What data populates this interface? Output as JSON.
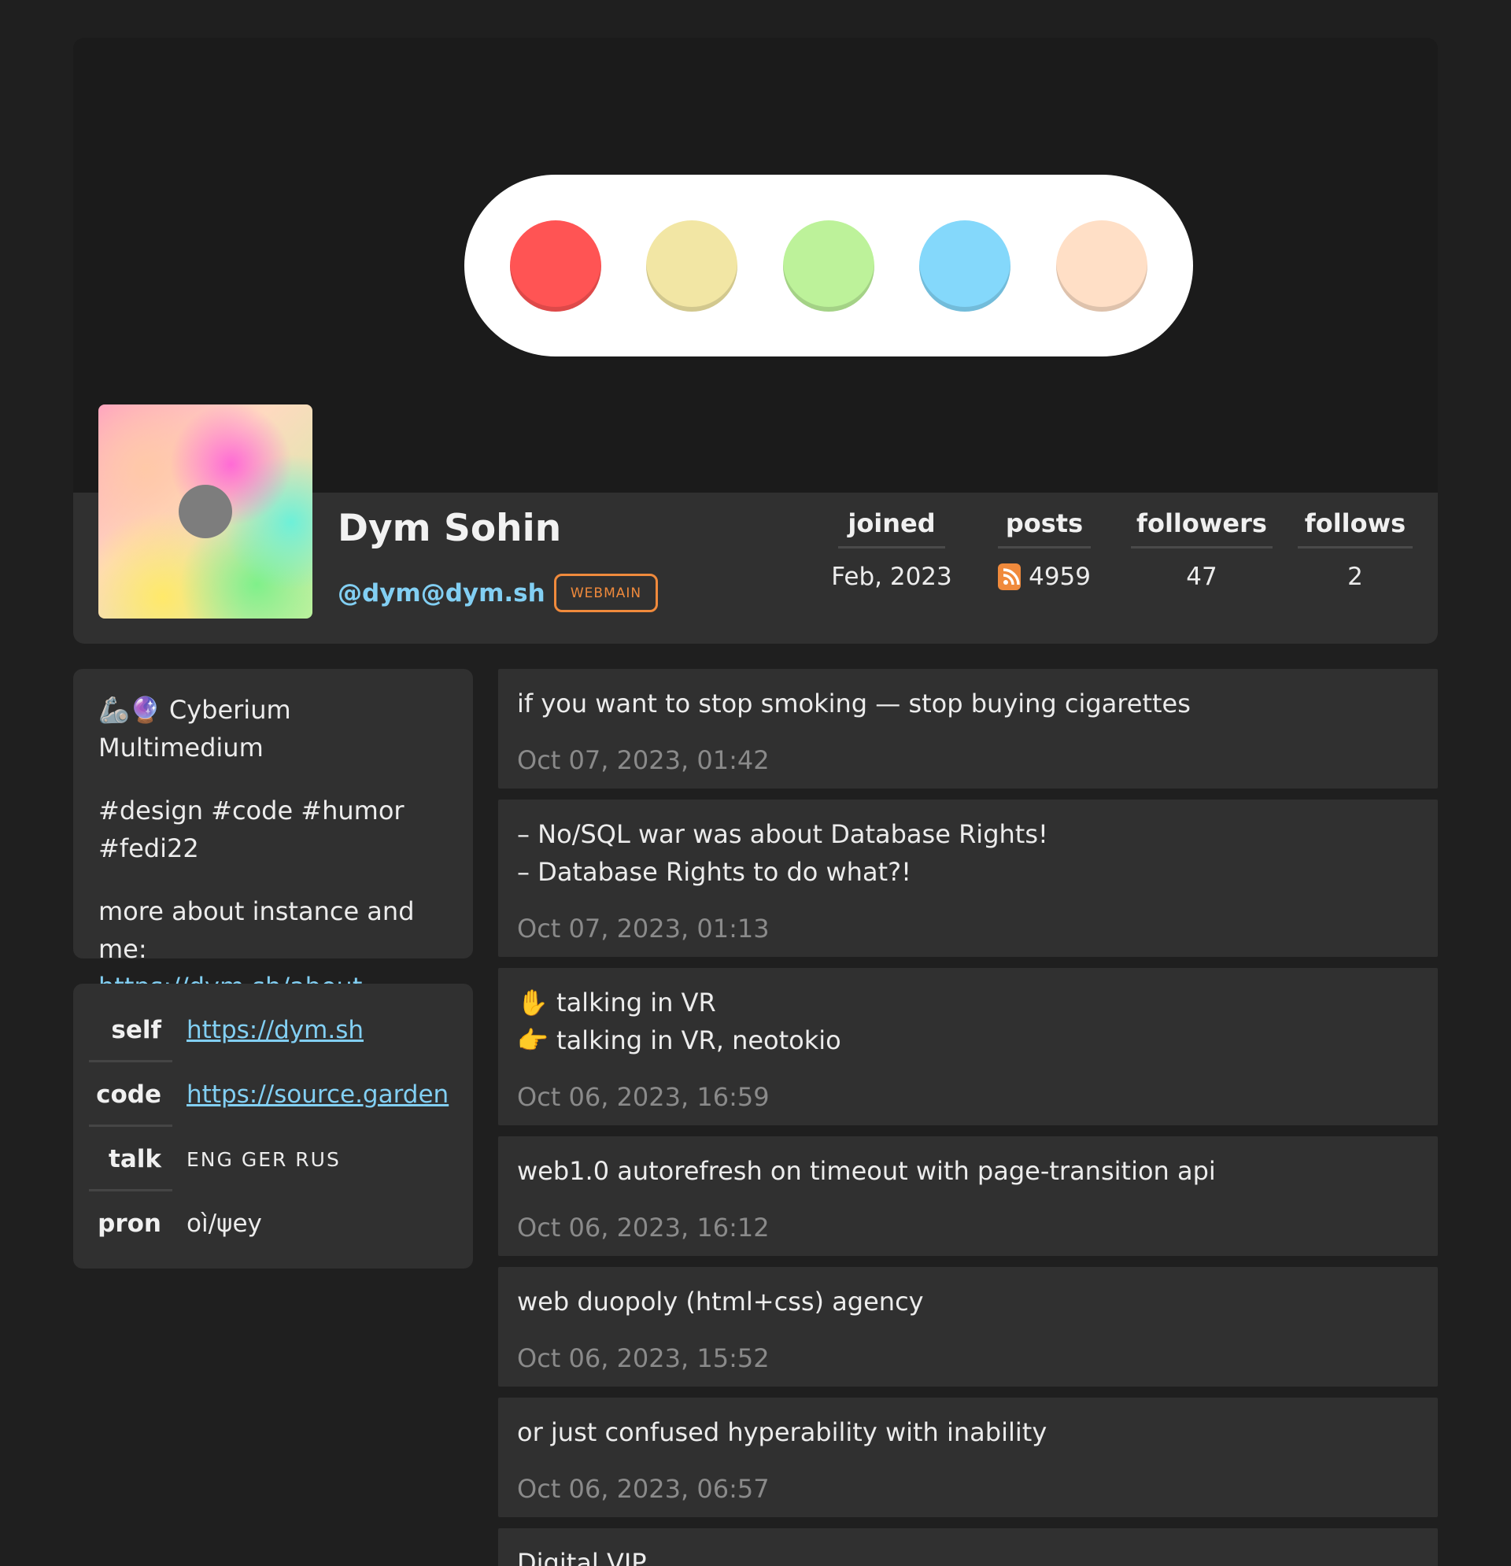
{
  "banner": {
    "dots": [
      {
        "color": "#ff5454"
      },
      {
        "color": "#f2e6a4"
      },
      {
        "color": "#bdf29a"
      },
      {
        "color": "#84d8fb"
      },
      {
        "color": "#ffdfc6"
      }
    ]
  },
  "profile": {
    "display_name": "Dym Sohin",
    "handle": "@dym@dym.sh",
    "badge": "WEBMAIN"
  },
  "stats": {
    "joined": {
      "label": "joined",
      "value": "Feb, 2023"
    },
    "posts": {
      "label": "posts",
      "value": "4959"
    },
    "followers": {
      "label": "followers",
      "value": "47"
    },
    "follows": {
      "label": "follows",
      "value": "2"
    }
  },
  "bio": {
    "tagline": "Cyberium Multimedium",
    "tags": "#design #code #humor #fedi22",
    "more_text": "more about instance and me:",
    "more_link": "https://dym.sh/about"
  },
  "fields": [
    {
      "key": "self",
      "value": "https://dym.sh"
    },
    {
      "key": "code",
      "value": "https://source.garden"
    },
    {
      "key": "talk",
      "value": "ENG GER RUS"
    },
    {
      "key": "pron",
      "value": "oì/ψey"
    }
  ],
  "posts": [
    {
      "text": "if you want to stop smoking — stop buying cigarettes",
      "time": "Oct 07, 2023, 01:42"
    },
    {
      "text": "– No/SQL war was about Database Rights!\n– Database Rights to do what?!",
      "time": "Oct 07, 2023, 01:13"
    },
    {
      "text": "✋ talking in VR\n👉 talking in VR, neotokio",
      "time": "Oct 06, 2023, 16:59"
    },
    {
      "text": "web1.0 autorefresh on timeout with page-transition api",
      "time": "Oct 06, 2023, 16:12"
    },
    {
      "text": "web duopoly (html+css) agency",
      "time": "Oct 06, 2023, 15:52"
    },
    {
      "text": "or just confused hyperability with inability",
      "time": "Oct 06, 2023, 06:57"
    },
    {
      "text": "Digital VIP",
      "time": ""
    }
  ]
}
